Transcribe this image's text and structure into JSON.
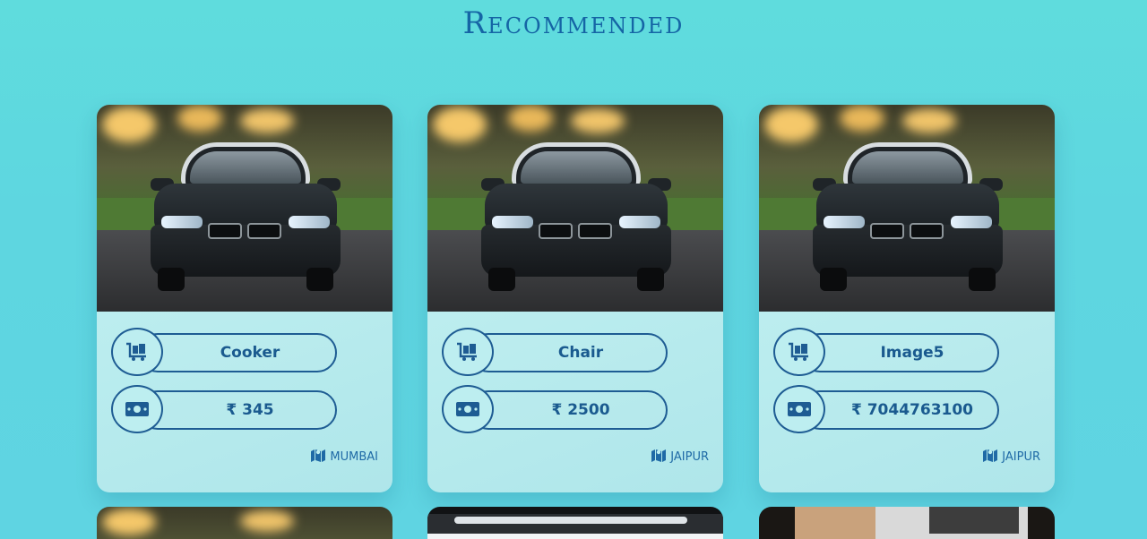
{
  "page": {
    "heading": "Recommended"
  },
  "cards": [
    {
      "name": "Cooker",
      "price": "₹ 345",
      "location": "MUMBAI"
    },
    {
      "name": "Chair",
      "price": "₹ 2500",
      "location": "JAIPUR"
    },
    {
      "name": "Image5",
      "price": "₹ 7044763100",
      "location": "JAIPUR"
    }
  ],
  "icons": {
    "product": "luggage-cart-icon",
    "price": "money-bill-icon",
    "location": "map-marked-icon"
  },
  "colors": {
    "accent": "#1565a5",
    "background": "#5fdcdd",
    "card": "#bdeef0"
  }
}
